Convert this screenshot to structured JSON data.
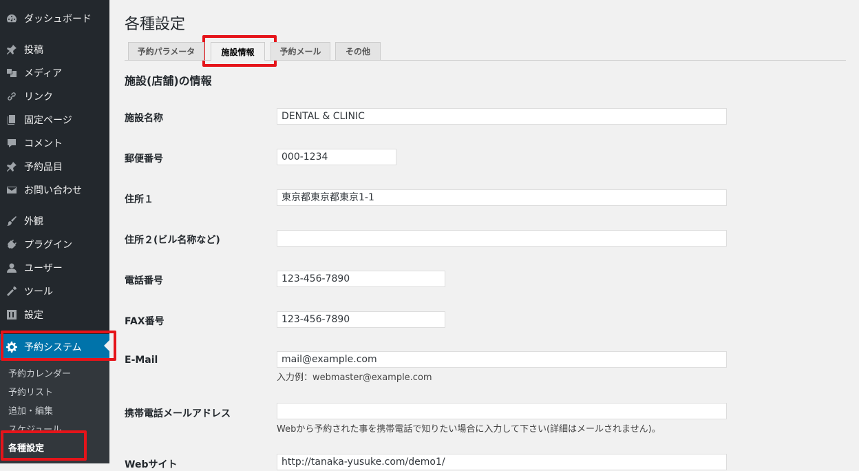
{
  "sidebar": {
    "items": [
      {
        "label": "ダッシュボード",
        "icon": "dashboard-icon"
      },
      {
        "label": "投稿",
        "icon": "pin-icon"
      },
      {
        "label": "メディア",
        "icon": "media-icon"
      },
      {
        "label": "リンク",
        "icon": "link-icon"
      },
      {
        "label": "固定ページ",
        "icon": "pages-icon"
      },
      {
        "label": "コメント",
        "icon": "comment-icon"
      },
      {
        "label": "予約品目",
        "icon": "pin-icon"
      },
      {
        "label": "お問い合わせ",
        "icon": "mail-icon"
      },
      {
        "label": "外観",
        "icon": "appearance-icon"
      },
      {
        "label": "プラグイン",
        "icon": "plugin-icon"
      },
      {
        "label": "ユーザー",
        "icon": "user-icon"
      },
      {
        "label": "ツール",
        "icon": "wrench-icon"
      },
      {
        "label": "設定",
        "icon": "settings-icon"
      },
      {
        "label": "予約システム",
        "icon": "gear-icon"
      }
    ],
    "submenu": [
      "予約カレンダー",
      "予約リスト",
      "追加・編集",
      "スケジュール",
      "各種設定"
    ],
    "accent": "#0073aa"
  },
  "main": {
    "title": "各種設定",
    "tabs": [
      "予約パラメータ",
      "施設情報",
      "予約メール",
      "その他"
    ],
    "section_title": "施設(店舗)の情報",
    "fields": [
      {
        "label": "施設名称",
        "value": "DENTAL & CLINIC"
      },
      {
        "label": "郵便番号",
        "value": "000-1234"
      },
      {
        "label": "住所１",
        "value": "東京都東京都東京1-1"
      },
      {
        "label": "住所２(ビル名称など)",
        "value": ""
      },
      {
        "label": "電話番号",
        "value": "123-456-7890"
      },
      {
        "label": "FAX番号",
        "value": "123-456-7890"
      },
      {
        "label": "E-Mail",
        "value": "mail@example.com",
        "hint": "入力例：webmaster@example.com"
      },
      {
        "label": "携帯電話メールアドレス",
        "value": "",
        "hint": "Webから予約された事を携帯電話で知りたい場合に入力して下さい(詳細はメールされません)。"
      },
      {
        "label": "Webサイト",
        "value": "http://tanaka-yusuke.com/demo1/"
      }
    ]
  }
}
